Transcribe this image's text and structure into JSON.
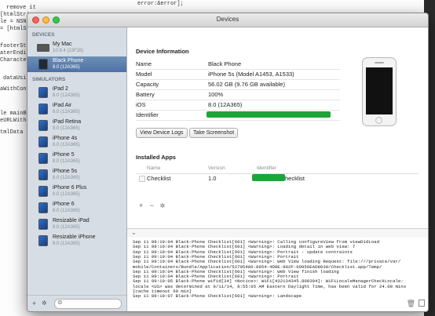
{
  "background_code": [
    "remove it",
    "[htmlStri",
    "le = NSN",
    "= [htmlSt",
    "footerSta",
    "aterEndi",
    "Characte",
    "dataUsin",
    "aWithCont",
    "le mainBu",
    "eURLWith",
    "tmlData M",
    "error:&error];"
  ],
  "window": {
    "title": "Devices"
  },
  "sidebar": {
    "devices_header": "DEVICES",
    "simulators_header": "SIMULATORS",
    "devices": [
      {
        "name": "My Mac",
        "sub": "10.9.4 (13F28)"
      },
      {
        "name": "Black Phone",
        "sub": "8.0 (12A365)"
      }
    ],
    "simulators": [
      {
        "name": "iPad 2",
        "sub": "8.0 (12A365)"
      },
      {
        "name": "iPad Air",
        "sub": "8.0 (12A365)"
      },
      {
        "name": "iPad Retina",
        "sub": "8.0 (12A365)"
      },
      {
        "name": "iPhone 4s",
        "sub": "8.0 (12A365)"
      },
      {
        "name": "iPhone 5",
        "sub": "8.0 (12A365)"
      },
      {
        "name": "iPhone 5s",
        "sub": "8.0 (12A365)"
      },
      {
        "name": "iPhone 6 Plus",
        "sub": "8.0 (12A365)"
      },
      {
        "name": "iPhone 6",
        "sub": "8.0 (12A365)"
      },
      {
        "name": "Resizable iPad",
        "sub": "8.0 (12A365)"
      },
      {
        "name": "Resizable iPhone",
        "sub": "8.0 (12A365)"
      }
    ],
    "footer": {
      "add": "+",
      "gear": "✲",
      "filter_icon": "⊜"
    }
  },
  "device_info": {
    "heading": "Device Information",
    "rows": [
      {
        "label": "Name",
        "value": "Black Phone"
      },
      {
        "label": "Model",
        "value": "iPhone 5s (Model A1453, A1533)"
      },
      {
        "label": "Capacity",
        "value": "56.02 GB (9.76 GB available)"
      },
      {
        "label": "Battery",
        "value": "100%"
      },
      {
        "label": "iOS",
        "value": "8.0 (12A365)"
      },
      {
        "label": "Identifier",
        "value": ""
      }
    ],
    "view_logs_button": "View Device Logs",
    "screenshot_button": "Take Screenshot"
  },
  "installed_apps": {
    "heading": "Installed Apps",
    "columns": [
      "Name",
      "Version",
      "Identifier"
    ],
    "rows": [
      {
        "name": "Checklist",
        "version": "1.0",
        "identifier_suffix": "hecklist"
      }
    ],
    "tools": {
      "add": "+",
      "remove": "−",
      "gear": "✲"
    }
  },
  "console": {
    "collapse_icon": "⌄",
    "lines": [
      "Sep 11 09:19:04 Black-Phone Checklist[601] <Warning>: Calling configureView from viewDidLoad",
      "Sep 11 09:19:04 Black-Phone Checklist[601] <Warning>: Loading detail in web view: 7",
      "Sep 11 09:19:04 Black-Phone Checklist[601] <Warning>: Portrait - update contraints",
      "Sep 11 09:19:04 Black-Phone Checklist[601] <Warning>: Portrait",
      "Sep 11 09:19:04 Black-Phone Checklist[601] <Warning>: Web View loading Request: file:///private/var/",
      "mobile/Containers/Bundle/Application/52705486-0954-4D0E-902F-69956EAD8030/Checklist.app/Temp/",
      "Sep 11 09:19:04 Black-Phone Checklist[601] <Warning>: Web View finish loading",
      "Sep 11 09:19:04 Black-Phone Checklist[601] <Warning>: Portrait",
      "Sep 11 09:19:05 Black-Phone wifid[34] <Notice>: WiFi[432134345.800304]: WiFiLocaleManagerCheckLocale:",
      "locale <US> was determined at 9/11/14, 8:55:05 AM Eastern Daylight Time, has been valid for 24.00 mins",
      "[cache timeout 60 min]",
      "Sep 11 09:19:07 Black-Phone Checklist[601] <Warning>: Landscape"
    ]
  },
  "colors": {
    "redaction": "#1fa43a",
    "selected": "#4d72a5"
  }
}
